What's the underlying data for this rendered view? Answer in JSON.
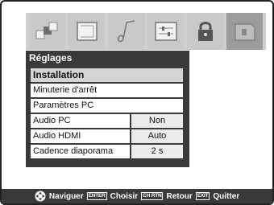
{
  "menu_title": "Réglages",
  "icons": [
    "picture-icon",
    "screen-icon",
    "music-note-icon",
    "settings-panel-icon",
    "lock-icon",
    "media-card-icon"
  ],
  "items": [
    {
      "label": "Installation",
      "value": null,
      "selected": true
    },
    {
      "label": "Minuterie d'arrêt",
      "value": null
    },
    {
      "label": "Paramètres PC",
      "value": null
    },
    {
      "label": "Audio PC",
      "value": "Non"
    },
    {
      "label": "Audio HDMI",
      "value": "Auto"
    },
    {
      "label": "Cadence diaporama",
      "value": "2 s"
    }
  ],
  "footer": {
    "navigate": "Naviguer",
    "enter_key": "ENTER",
    "enter_label": "Choisir",
    "rtn_key": "CH RTN",
    "rtn_label": "Retour",
    "exit_key": "EXIT",
    "exit_label": "Quitter"
  }
}
